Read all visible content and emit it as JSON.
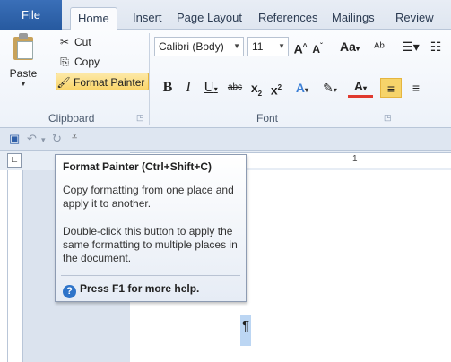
{
  "tabs": [
    "File",
    "Home",
    "Insert",
    "Page Layout",
    "References",
    "Mailings",
    "Review"
  ],
  "clipboard": {
    "paste_label": "Paste",
    "cut_label": "Cut",
    "copy_label": "Copy",
    "format_painter_label": "Format Painter",
    "group_label": "Clipboard"
  },
  "font": {
    "family": "Calibri (Body)",
    "size": "11",
    "group_label": "Font",
    "case_label": "Aa"
  },
  "ruler": {
    "marker": "1"
  },
  "doc": {
    "pilcrow": "¶"
  },
  "tooltip": {
    "title": "Format Painter (Ctrl+Shift+C)",
    "p1": "Copy formatting from one place and apply it to another.",
    "p2": "Double-click this button to apply the same formatting to multiple places in the document.",
    "help": "Press F1 for more help."
  },
  "colors": {
    "file_tab": "#2a5fa8",
    "highlight": "#f9d56a",
    "text_color_bar": "#e03a2f"
  }
}
